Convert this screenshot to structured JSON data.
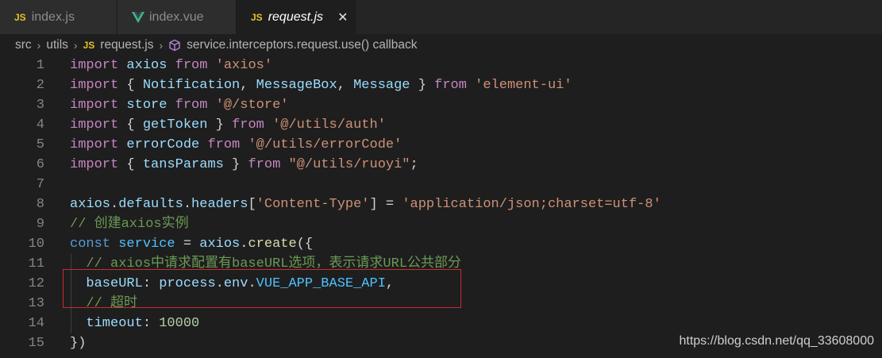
{
  "tabs": [
    {
      "label": "index.js",
      "icon": "js-file-icon"
    },
    {
      "label": "index.vue",
      "icon": "vue-file-icon"
    },
    {
      "label": "request.js",
      "icon": "js-file-icon",
      "active": true
    }
  ],
  "close_glyph": "✕",
  "breadcrumb": {
    "parts": [
      "src",
      "utils",
      "request.js",
      "service.interceptors.request.use() callback"
    ],
    "separator": "›"
  },
  "code": {
    "line_numbers": [
      "1",
      "2",
      "3",
      "4",
      "5",
      "6",
      "7",
      "8",
      "9",
      "10",
      "11",
      "12",
      "13",
      "14",
      "15"
    ],
    "lines": [
      [
        [
          "import",
          "kw2"
        ],
        [
          " ",
          ""
        ],
        [
          "axios",
          "var"
        ],
        [
          " ",
          ""
        ],
        [
          "from",
          "kw2"
        ],
        [
          " ",
          ""
        ],
        [
          "'axios'",
          "str"
        ]
      ],
      [
        [
          "import",
          "kw2"
        ],
        [
          " { ",
          "pun"
        ],
        [
          "Notification",
          "var"
        ],
        [
          ", ",
          "pun"
        ],
        [
          "MessageBox",
          "var"
        ],
        [
          ", ",
          "pun"
        ],
        [
          "Message",
          "var"
        ],
        [
          " } ",
          "pun"
        ],
        [
          "from",
          "kw2"
        ],
        [
          " ",
          ""
        ],
        [
          "'element-ui'",
          "str"
        ]
      ],
      [
        [
          "import",
          "kw2"
        ],
        [
          " ",
          ""
        ],
        [
          "store",
          "var"
        ],
        [
          " ",
          ""
        ],
        [
          "from",
          "kw2"
        ],
        [
          " ",
          ""
        ],
        [
          "'@/store'",
          "str"
        ]
      ],
      [
        [
          "import",
          "kw2"
        ],
        [
          " { ",
          "pun"
        ],
        [
          "getToken",
          "var"
        ],
        [
          " } ",
          "pun"
        ],
        [
          "from",
          "kw2"
        ],
        [
          " ",
          ""
        ],
        [
          "'@/utils/auth'",
          "str"
        ]
      ],
      [
        [
          "import",
          "kw2"
        ],
        [
          " ",
          ""
        ],
        [
          "errorCode",
          "var"
        ],
        [
          " ",
          ""
        ],
        [
          "from",
          "kw2"
        ],
        [
          " ",
          ""
        ],
        [
          "'@/utils/errorCode'",
          "str"
        ]
      ],
      [
        [
          "import",
          "kw2"
        ],
        [
          " { ",
          "pun"
        ],
        [
          "tansParams",
          "var"
        ],
        [
          " } ",
          "pun"
        ],
        [
          "from",
          "kw2"
        ],
        [
          " ",
          ""
        ],
        [
          "\"@/utils/ruoyi\"",
          "str"
        ],
        [
          ";",
          "pun"
        ]
      ],
      [],
      [
        [
          "axios",
          "var"
        ],
        [
          ".",
          "pun"
        ],
        [
          "defaults",
          "var"
        ],
        [
          ".",
          "pun"
        ],
        [
          "headers",
          "var"
        ],
        [
          "[",
          "pun"
        ],
        [
          "'Content-Type'",
          "str"
        ],
        [
          "] = ",
          "pun"
        ],
        [
          "'application/json;charset=utf-8'",
          "str"
        ]
      ],
      [
        [
          "// 创建axios实例",
          "cm"
        ]
      ],
      [
        [
          "const",
          "kw"
        ],
        [
          " ",
          ""
        ],
        [
          "service",
          "cnst"
        ],
        [
          " = ",
          "pun"
        ],
        [
          "axios",
          "var"
        ],
        [
          ".",
          "pun"
        ],
        [
          "create",
          "fn"
        ],
        [
          "({",
          "pun"
        ]
      ],
      [
        [
          "  ",
          ""
        ],
        [
          "// axios中请求配置有baseURL选项，表示请求URL公共部分",
          "cm"
        ]
      ],
      [
        [
          "  ",
          ""
        ],
        [
          "baseURL",
          "var"
        ],
        [
          ": ",
          "pun"
        ],
        [
          "process",
          "var"
        ],
        [
          ".",
          "pun"
        ],
        [
          "env",
          "var"
        ],
        [
          ".",
          "pun"
        ],
        [
          "VUE_APP_BASE_API",
          "cnst"
        ],
        [
          ",",
          "pun"
        ]
      ],
      [
        [
          "  ",
          ""
        ],
        [
          "// 超时",
          "cm"
        ]
      ],
      [
        [
          "  ",
          ""
        ],
        [
          "timeout",
          "var"
        ],
        [
          ": ",
          "pun"
        ],
        [
          "10000",
          "num"
        ]
      ],
      [
        [
          "})",
          "pun"
        ]
      ]
    ]
  },
  "watermark": "https://blog.csdn.net/qq_33608000",
  "colors": {
    "editor_bg": "#1e1e1e",
    "keyword": "#c586c0",
    "string": "#ce9178",
    "comment": "#6a9955",
    "highlight_box": "#cc2a2a"
  }
}
